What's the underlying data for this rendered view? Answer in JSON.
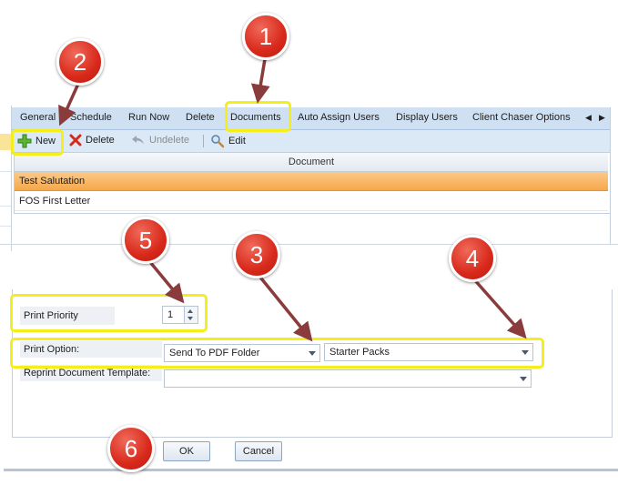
{
  "tabs": [
    {
      "label": "General"
    },
    {
      "label": "Schedule"
    },
    {
      "label": "Run Now"
    },
    {
      "label": "Delete"
    },
    {
      "label": "Documents"
    },
    {
      "label": "Auto Assign Users"
    },
    {
      "label": "Display Users"
    },
    {
      "label": "Client Chaser Options"
    }
  ],
  "toolbar": {
    "new_label": "New",
    "delete_label": "Delete",
    "undelete_label": "Undelete",
    "edit_label": "Edit"
  },
  "grid": {
    "header": "Document",
    "rows": [
      {
        "document": "Test Salutation"
      },
      {
        "document": "FOS First Letter"
      }
    ]
  },
  "form": {
    "print_priority_label": "Print Priority",
    "print_priority_value": "1",
    "print_option_label": "Print Option:",
    "print_option_value": "Send To PDF Folder",
    "print_option_template": "Starter Packs",
    "reprint_label": "Reprint Document Template:",
    "reprint_value": ""
  },
  "buttons": {
    "ok": "OK",
    "cancel": "Cancel"
  },
  "callouts": [
    "1",
    "2",
    "3",
    "4",
    "5",
    "6"
  ],
  "colors": {
    "selected_row": "#f6a84b",
    "highlight": "#f4ee1d",
    "callout": "#d8291b"
  }
}
